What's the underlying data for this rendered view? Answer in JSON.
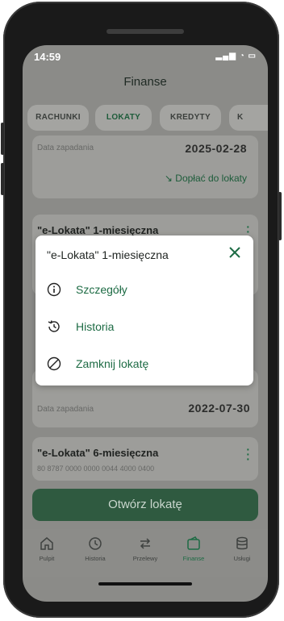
{
  "status": {
    "time": "14:59",
    "icons": "signal-wifi-battery"
  },
  "header": {
    "title": "Finanse"
  },
  "tabs": [
    "RACHUNKI",
    "LOKATY",
    "KREDYTY",
    "K"
  ],
  "card1": {
    "label": "Data zapadania",
    "date": "2025-02-28",
    "link": "Dopłać do lokaty"
  },
  "card2": {
    "title": "\"e-Lokata\" 1-miesięczna"
  },
  "card3": {
    "label": "Data zapadania",
    "date": "2022-07-30"
  },
  "card4": {
    "title": "\"e-Lokata\" 6-miesięczna",
    "number": "80 8787 0000 0000 0044 4000 0400"
  },
  "modal": {
    "title": "\"e-Lokata\" 1-miesięczna",
    "items": [
      {
        "label": "Szczegóły",
        "icon": "info-icon"
      },
      {
        "label": "Historia",
        "icon": "history-icon"
      },
      {
        "label": "Zamknij lokatę",
        "icon": "close-circle-icon"
      }
    ]
  },
  "cta": {
    "label": "Otwórz lokatę"
  },
  "nav": [
    {
      "label": "Pulpit",
      "icon": "home-icon"
    },
    {
      "label": "Historia",
      "icon": "history-icon"
    },
    {
      "label": "Przelewy",
      "icon": "transfer-icon"
    },
    {
      "label": "Finanse",
      "icon": "wallet-icon"
    },
    {
      "label": "Usługi",
      "icon": "database-icon"
    }
  ],
  "colors": {
    "accent": "#1d6b44",
    "overlay": "#8b8b88",
    "cta": "#2f5a40"
  }
}
